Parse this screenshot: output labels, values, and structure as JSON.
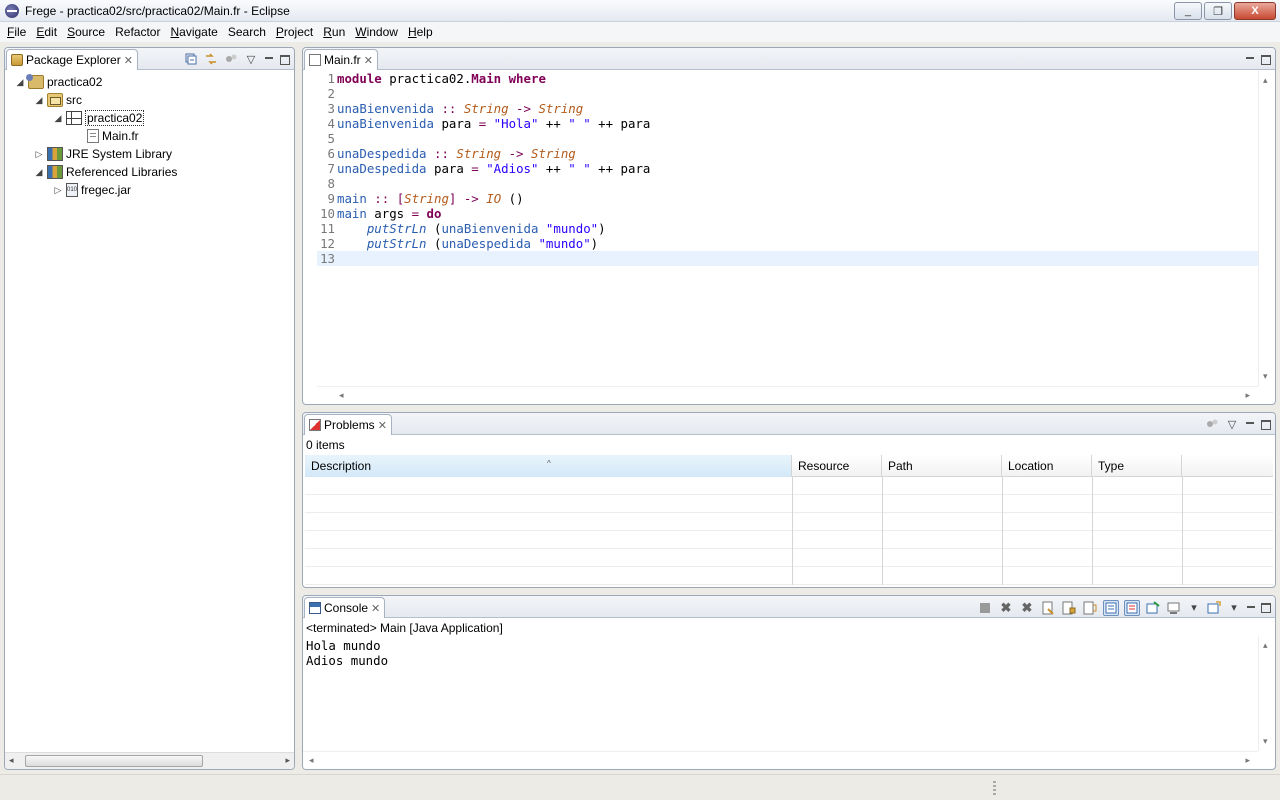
{
  "window": {
    "title": "Frege - practica02/src/practica02/Main.fr - Eclipse"
  },
  "menu": [
    {
      "label": "File",
      "mn": "F",
      "rest": "ile"
    },
    {
      "label": "Edit",
      "mn": "E",
      "rest": "dit"
    },
    {
      "label": "Source",
      "mn": "S",
      "rest": "ource"
    },
    {
      "label": "Refactor",
      "mn": "",
      "rest": "Refactor"
    },
    {
      "label": "Navigate",
      "mn": "N",
      "rest": "avigate"
    },
    {
      "label": "Search",
      "mn": "",
      "rest": "Search"
    },
    {
      "label": "Project",
      "mn": "P",
      "rest": "roject"
    },
    {
      "label": "Run",
      "mn": "R",
      "rest": "un"
    },
    {
      "label": "Window",
      "mn": "W",
      "rest": "indow"
    },
    {
      "label": "Help",
      "mn": "H",
      "rest": "elp"
    }
  ],
  "package_explorer": {
    "tab_label": "Package Explorer",
    "tree": [
      {
        "label": "practica02",
        "icon": "project-icon",
        "twisty": "◢",
        "depth": 0
      },
      {
        "label": "src",
        "icon": "source-folder-icon",
        "twisty": "◢",
        "depth": 1
      },
      {
        "label": "practica02",
        "icon": "package-icon",
        "twisty": "◢",
        "depth": 2
      },
      {
        "label": "Main.fr",
        "icon": "file-icon",
        "twisty": "",
        "depth": 3
      },
      {
        "label": "JRE System Library",
        "icon": "library-icon",
        "twisty": "▷",
        "depth": 1
      },
      {
        "label": "Referenced Libraries",
        "icon": "library-icon",
        "twisty": "◢",
        "depth": 1
      },
      {
        "label": "fregec.jar",
        "icon": "jar-icon",
        "twisty": "▷",
        "depth": 2
      }
    ],
    "jar_icon_text": "010"
  },
  "editor": {
    "tab_label": "Main.fr",
    "line_numbers": [
      "1",
      "2",
      "3",
      "4",
      "5",
      "6",
      "7",
      "8",
      "9",
      "10",
      "11",
      "12",
      "13"
    ],
    "code": {
      "l1_kw": "module",
      "l1_mod": " practica02.",
      "l1_main": "Main",
      "l1_where": " where",
      "l3_fn": "unaBienvenida",
      "l3_sig": " :: ",
      "l3_t1": "String",
      "l3_arr": " -> ",
      "l3_t2": "String",
      "l4_fn": "unaBienvenida",
      "l4_args": " para ",
      "l4_eq": "=",
      "l4_s1": " \"Hola\"",
      "l4_op1": " ++ ",
      "l4_s2": "\" \"",
      "l4_op2": " ++ ",
      "l4_p": "para",
      "l6_fn": "unaDespedida",
      "l6_sig": " :: ",
      "l6_t1": "String",
      "l6_arr": " -> ",
      "l6_t2": "String",
      "l7_fn": "unaDespedida",
      "l7_args": " para ",
      "l7_eq": "=",
      "l7_s1": " \"Adios\"",
      "l7_op1": " ++ ",
      "l7_s2": "\" \"",
      "l7_op2": " ++ ",
      "l7_p": "para",
      "l9_fn": "main",
      "l9_sig": " :: ",
      "l9_b1": "[",
      "l9_t1": "String",
      "l9_b2": "]",
      "l9_arr": " -> ",
      "l9_io": "IO",
      "l9_unit": " ()",
      "l10_fn": "main",
      "l10_args": " args ",
      "l10_eq": "=",
      "l10_do": " do",
      "l11_ind": "    ",
      "l11_put": "putStrLn",
      "l11_p1": " (",
      "l11_fn": "unaBienvenida",
      "l11_s": " \"mundo\"",
      "l11_p2": ")",
      "l12_ind": "    ",
      "l12_put": "putStrLn",
      "l12_p1": " (",
      "l12_fn": "unaDespedida",
      "l12_s": " \"mundo\"",
      "l12_p2": ")"
    }
  },
  "problems": {
    "tab_label": "Problems",
    "count": "0 items",
    "columns": [
      "Description",
      "Resource",
      "Path",
      "Location",
      "Type"
    ],
    "sort_indicator": "^"
  },
  "console": {
    "tab_label": "Console",
    "status": "<terminated> Main [Java Application]",
    "output": [
      "Hola mundo",
      "Adios mundo"
    ]
  },
  "window_buttons": {
    "minimize": "_",
    "maximize": "❐",
    "close": "X"
  },
  "glyphs": {
    "close_tab": "✕",
    "menu_arrow": "▽",
    "scroll_left": "◂",
    "scroll_right": "▸",
    "scroll_up": "▴",
    "scroll_down": "▾"
  },
  "colors": {
    "keyword": "#7f0055",
    "type": "#b35a1a",
    "function": "#2a5db0",
    "string": "#2a00ff",
    "current_line": "#e8f2fe"
  }
}
